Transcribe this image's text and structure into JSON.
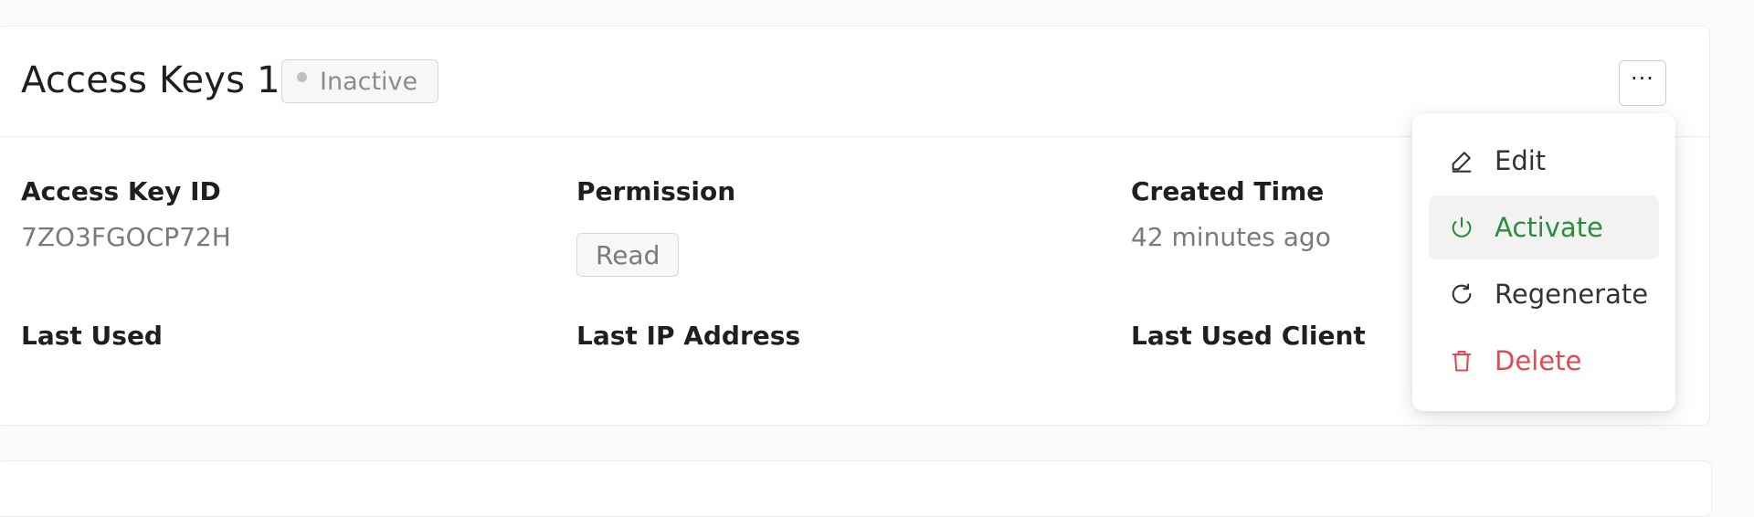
{
  "card": {
    "title": "Access Keys 1",
    "status": "Inactive",
    "more_label": "···"
  },
  "fields": {
    "access_key_id_label": "Access Key ID",
    "access_key_id_value": "7ZO3FGOCP72H",
    "permission_label": "Permission",
    "permission_value": "Read",
    "created_time_label": "Created Time",
    "created_time_value": "42 minutes ago",
    "last_used_label": "Last Used",
    "last_ip_label": "Last IP Address",
    "last_client_label": "Last Used Client"
  },
  "menu": {
    "items": [
      {
        "label": "Edit",
        "icon": "pencil-icon",
        "color": "#333333"
      },
      {
        "label": "Activate",
        "icon": "power-icon",
        "color": "#2e8b3d"
      },
      {
        "label": "Regenerate",
        "icon": "refresh-icon",
        "color": "#333333"
      },
      {
        "label": "Delete",
        "icon": "trash-icon",
        "color": "#e5484d"
      }
    ]
  }
}
